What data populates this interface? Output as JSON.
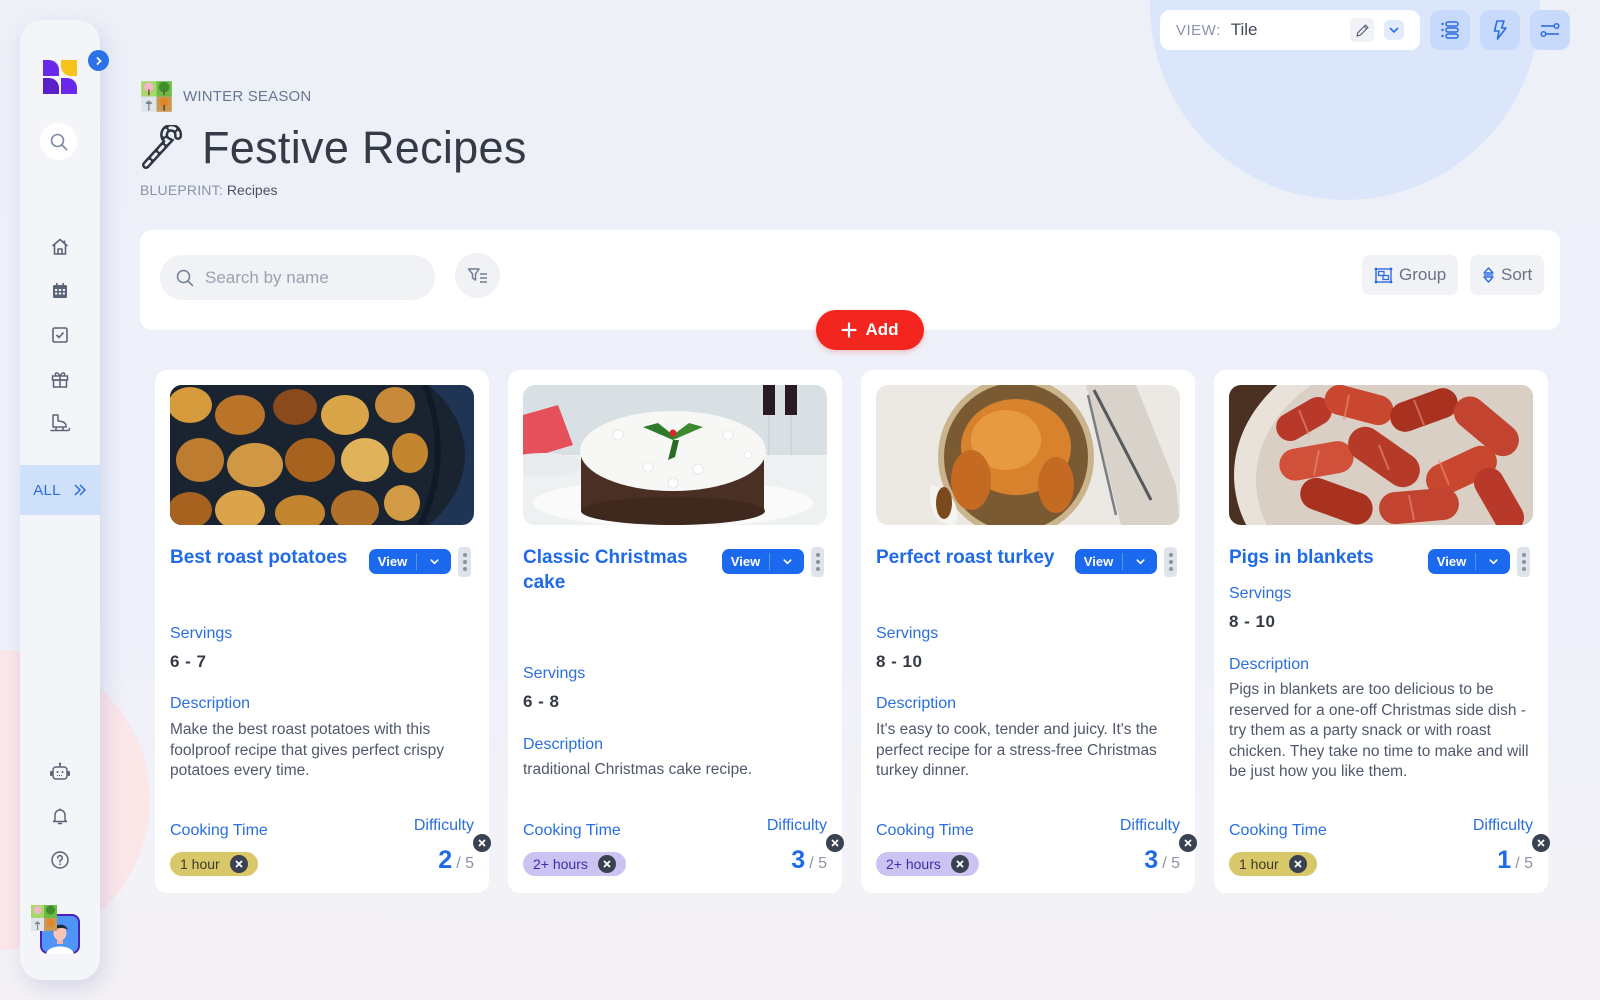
{
  "header": {
    "season_label": "WINTER SEASON",
    "page_title": "Festive Recipes",
    "blueprint_key": "BLUEPRINT:",
    "blueprint_value": "Recipes"
  },
  "view_selector": {
    "label": "VIEW:",
    "value": "Tile"
  },
  "top_actions": [
    "list-settings",
    "automations",
    "view-settings"
  ],
  "sidebar": {
    "items": [
      {
        "name": "home",
        "icon": "home-icon"
      },
      {
        "name": "calendar",
        "icon": "calendar-icon"
      },
      {
        "name": "tasks",
        "icon": "checkbox-icon"
      },
      {
        "name": "gifts",
        "icon": "gift-icon"
      },
      {
        "name": "skating",
        "icon": "ice-skate-icon"
      }
    ],
    "all_label": "ALL",
    "bottom_items": [
      {
        "name": "assistant",
        "icon": "robot-icon"
      },
      {
        "name": "notifications",
        "icon": "bell-icon"
      },
      {
        "name": "help",
        "icon": "help-icon"
      }
    ]
  },
  "toolbar": {
    "search_placeholder": "Search by name",
    "search_value": "",
    "group_label": "Group",
    "sort_label": "Sort",
    "add_label": "Add"
  },
  "colors": {
    "accent": "#1f6ae8",
    "add_button": "#f2261f",
    "chip_1_hour": "#d9c86a",
    "chip_2_hours": "#cbc4f3"
  },
  "labels": {
    "servings": "Servings",
    "description": "Description",
    "cooking_time": "Cooking Time",
    "difficulty": "Difficulty",
    "view_button": "View",
    "difficulty_max": "/ 5"
  },
  "recipes": [
    {
      "title": "Best roast potatoes",
      "image": "roast potatoes in a dark pan",
      "servings": "6 - 7",
      "description": "Make the best roast potatoes with this foolproof recipe that gives perfect crispy potatoes every time.",
      "cooking_time": "1 hour",
      "difficulty": "2"
    },
    {
      "title": "Classic Christmas cake",
      "image": "iced fruit cake with holly",
      "servings": "6 - 8",
      "description": "traditional Christmas cake recipe.",
      "cooking_time": "2+ hours",
      "difficulty": "3"
    },
    {
      "title": "Perfect roast turkey",
      "image": "roast turkey on a platter with gravy",
      "servings": "8 - 10",
      "description": "It's easy to cook, tender and juicy. It's the perfect recipe for a stress-free Christmas turkey dinner.",
      "cooking_time": "2+ hours",
      "difficulty": "3"
    },
    {
      "title": "Pigs in blankets",
      "image": "bacon-wrapped sausages in a bowl",
      "servings": "8 - 10",
      "description": "Pigs in blankets are too delicious to be reserved for a one-off Christmas side dish - try them as a party snack or with roast chicken. They take no time to make and will be just how you like them.",
      "cooking_time": "1 hour",
      "difficulty": "1"
    }
  ]
}
